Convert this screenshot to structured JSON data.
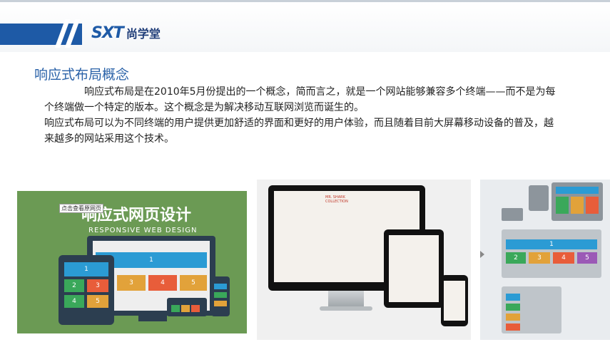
{
  "header": {
    "logo_mark": "SXT",
    "logo_text": "尚学堂"
  },
  "slide": {
    "title": "响应式布局概念",
    "paragraph1": "响应式布局是在2010年5月份提出的一个概念，简而言之，就是一个网站能够兼容多个终端——而不是为每个终端做一个特定的版本。这个概念是为解决移动互联网浏览而诞生的。",
    "paragraph2": "响应式布局可以为不同终端的用户提供更加舒适的界面和更好的用户体验，而且随着目前大屏幕移动设备的普及，越来越多的网站采用这个技术。"
  },
  "images": {
    "green_title": "响应式网页设计",
    "green_subtitle": "RESPONSIVE WEB DESIGN",
    "tooltip": "点击查看原网页",
    "monitor_labels": [
      "1",
      "2",
      "3",
      "4",
      "5"
    ],
    "monitor_colors": [
      "#2b9bd4",
      "#3aa85a",
      "#e2a23a",
      "#e85d3a",
      "#9aa0a6"
    ],
    "devices_title": "MR. SHARK COLLECTION",
    "diagram_labels": [
      "1",
      "2",
      "3",
      "4",
      "5"
    ],
    "diagram_colors": [
      "#2b9bd4",
      "#3aa85a",
      "#e2a23a",
      "#e85d3a",
      "#9b59b6"
    ]
  }
}
